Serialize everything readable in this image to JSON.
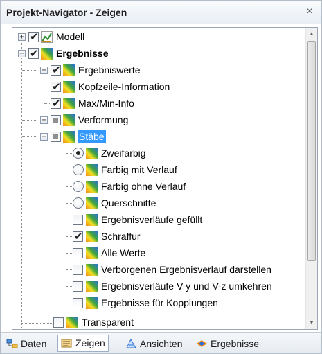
{
  "window": {
    "title": "Projekt-Navigator - Zeigen",
    "close_label": "×"
  },
  "tree": {
    "modell": {
      "label": "Modell",
      "checked": true,
      "expander": "+"
    },
    "ergebnisse": {
      "label": "Ergebnisse",
      "checked": true,
      "expander": "−"
    },
    "ergebniswerte": {
      "label": "Ergebniswerte",
      "checked": true,
      "expander": "+"
    },
    "kopfzeile": {
      "label": "Kopfzeile-Information",
      "checked": true
    },
    "maxmin": {
      "label": "Max/Min-Info",
      "checked": true
    },
    "verformung": {
      "label": "Verformung",
      "state": "partial",
      "expander": "+"
    },
    "staebe": {
      "label": "Stäbe",
      "state": "partial",
      "expander": "−",
      "selected": true
    },
    "zweifarbig": {
      "label": "Zweifarbig",
      "radio": "on"
    },
    "farbig_mit": {
      "label": "Farbig mit Verlauf",
      "radio": "off"
    },
    "farbig_ohne": {
      "label": "Farbig ohne Verlauf",
      "radio": "off"
    },
    "querschnitte": {
      "label": "Querschnitte",
      "radio": "off"
    },
    "verlaeufe_gefuellt": {
      "label": "Ergebnisverläufe gefüllt",
      "checked": false
    },
    "schraffur": {
      "label": "Schraffur",
      "checked": true
    },
    "alle_werte": {
      "label": "Alle Werte",
      "checked": false
    },
    "verborgenen": {
      "label": "Verborgenen Ergebnisverlauf darstellen",
      "checked": false
    },
    "umkehren": {
      "label": "Ergebnisverläufe V-y und V-z umkehren",
      "checked": false
    },
    "kopplungen": {
      "label": "Ergebnisse für Kopplungen",
      "checked": false
    },
    "transparent": {
      "label": "Transparent",
      "checked": false
    }
  },
  "check_glyph": "✔",
  "tabs": [
    {
      "label": "Daten",
      "icon": "data-tree-icon"
    },
    {
      "label": "Zeigen",
      "icon": "display-icon",
      "active": true
    },
    {
      "label": "Ansichten",
      "icon": "views-icon"
    },
    {
      "label": "Ergebnisse",
      "icon": "results-icon"
    }
  ],
  "colors": {
    "selection": "#3399ff",
    "accent_orange": "#f28a1c",
    "accent_green": "#3fa33f",
    "accent_blue": "#2a6fd6"
  }
}
